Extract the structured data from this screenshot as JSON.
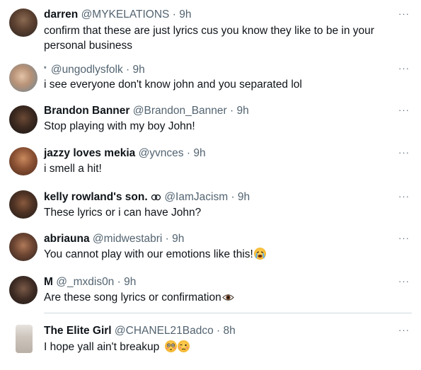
{
  "replies": [
    {
      "name": "darren",
      "handle": "@MYKELATIONS",
      "sep": "·",
      "time": "9h",
      "text": "confirm that these are just lyrics cus you know they like to be in your personal business",
      "more": "···"
    },
    {
      "name": "*",
      "handle": "@ungodlysfolk",
      "sep": "·",
      "time": "9h",
      "text": "i see everyone don't know john and you separated lol",
      "more": "···"
    },
    {
      "name": "Brandon Banner",
      "handle": "@Brandon_Banner",
      "sep": "·",
      "time": "9h",
      "text": "Stop playing with my boy John!",
      "more": "···"
    },
    {
      "name": "jazzy loves mekia",
      "handle": "@yvnces",
      "sep": "·",
      "time": "9h",
      "text": "i smell a hit!",
      "more": "···"
    },
    {
      "name": "kelly rowland's son.",
      "handle": "@IamJacism",
      "sep": "·",
      "time": "9h",
      "text": "These lyrics or i can have John?",
      "more": "···"
    },
    {
      "name": "abriauna",
      "handle": "@midwestabri",
      "sep": "·",
      "time": "9h",
      "text": "You cannot play with our emotions like this!",
      "more": "···"
    },
    {
      "name": "M",
      "handle": "@_mxdis0n",
      "sep": "·",
      "time": "9h",
      "text": "Are these song lyrics or confirmation",
      "more": "···"
    },
    {
      "name": "The Elite Girl",
      "handle": "@CHANEL21Badco",
      "sep": "·",
      "time": "8h",
      "text": "I hope yall ain't breakup",
      "more": "···"
    }
  ],
  "icons": {
    "kelly_badge": "link-chain-icon",
    "abriauna_emoji": "crying-face-emoji",
    "m_emoji": "eye-emoji",
    "elite_emoji_1": "flushed-face-emoji",
    "elite_emoji_2": "woozy-face-emoji"
  },
  "colors": {
    "text": "#0f1419",
    "secondary": "#536471",
    "divider": "#cfd9de",
    "emoji_yellow": "#f7c242"
  }
}
